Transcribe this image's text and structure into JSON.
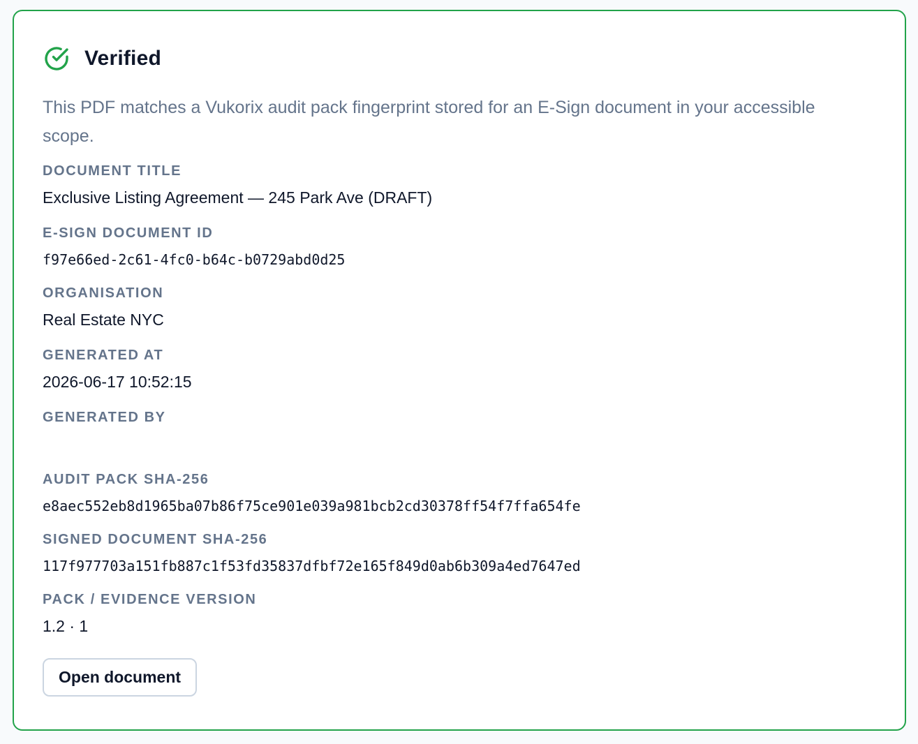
{
  "status": {
    "icon": "check-circle-icon",
    "title": "Verified",
    "color": "#22a34a"
  },
  "description": "This PDF matches a Vukorix audit pack fingerprint stored for an E-Sign document in your accessible scope.",
  "fields": [
    {
      "label": "Document title",
      "value": "Exclusive Listing Agreement — 245 Park Ave (DRAFT)"
    },
    {
      "label": "E-Sign document ID",
      "value": "f97e66ed-2c61-4fc0-b64c-b0729abd0d25"
    },
    {
      "label": "Organisation",
      "value": "Real Estate NYC"
    },
    {
      "label": "Generated at",
      "value": "2026-06-17 10:52:15"
    },
    {
      "label": "Generated by",
      "value": ""
    },
    {
      "label": "Audit pack SHA-256",
      "value": "e8aec552eb8d1965ba07b86f75ce901e039a981bcb2cd30378ff54f7ffa654fe"
    },
    {
      "label": "Signed document SHA-256",
      "value": "117f977703a151fb887c1f53fd35837dfbf72e165f849d0ab6b309a4ed7647ed"
    },
    {
      "label": "Pack / evidence version",
      "value": "1.2 · 1"
    }
  ],
  "actions": {
    "open_document_label": "Open document"
  }
}
